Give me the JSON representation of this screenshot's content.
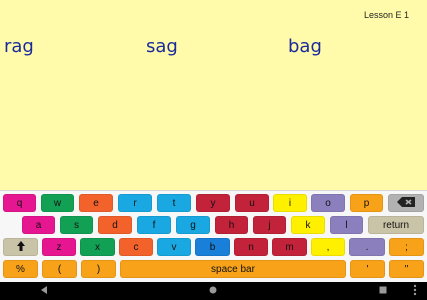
{
  "lesson": "Lesson E 1",
  "words": [
    "rag",
    "sag",
    "bag"
  ],
  "colors": {
    "pink": "#e5168f",
    "green": "#12a055",
    "orange": "#f2622a",
    "cyan": "#19a8e2",
    "blue": "#1a7fd8",
    "red": "#c2233a",
    "yellow": "#fff000",
    "purple": "#8c7fbd",
    "amber": "#f8a21a",
    "gray": "#b2b2b2",
    "tan": "#c9c4a8",
    "background": "#fffbaa",
    "word": "#1a2a9a"
  },
  "keyboard": {
    "row1": [
      "q",
      "w",
      "e",
      "r",
      "t",
      "y",
      "u",
      "i",
      "o",
      "p",
      "backspace-icon"
    ],
    "row2": [
      "a",
      "s",
      "d",
      "f",
      "g",
      "h",
      "j",
      "k",
      "l",
      "return"
    ],
    "row3": [
      "shift-icon",
      "z",
      "x",
      "c",
      "v",
      "b",
      "n",
      "m",
      ",",
      ".",
      ";"
    ],
    "row4": [
      "%",
      "(",
      ")",
      "space bar",
      "'",
      "\""
    ]
  },
  "navbar": {
    "back_icon": "back-icon",
    "home_icon": "home-icon",
    "recents_icon": "recents-icon",
    "more_icon": "more-icon"
  }
}
